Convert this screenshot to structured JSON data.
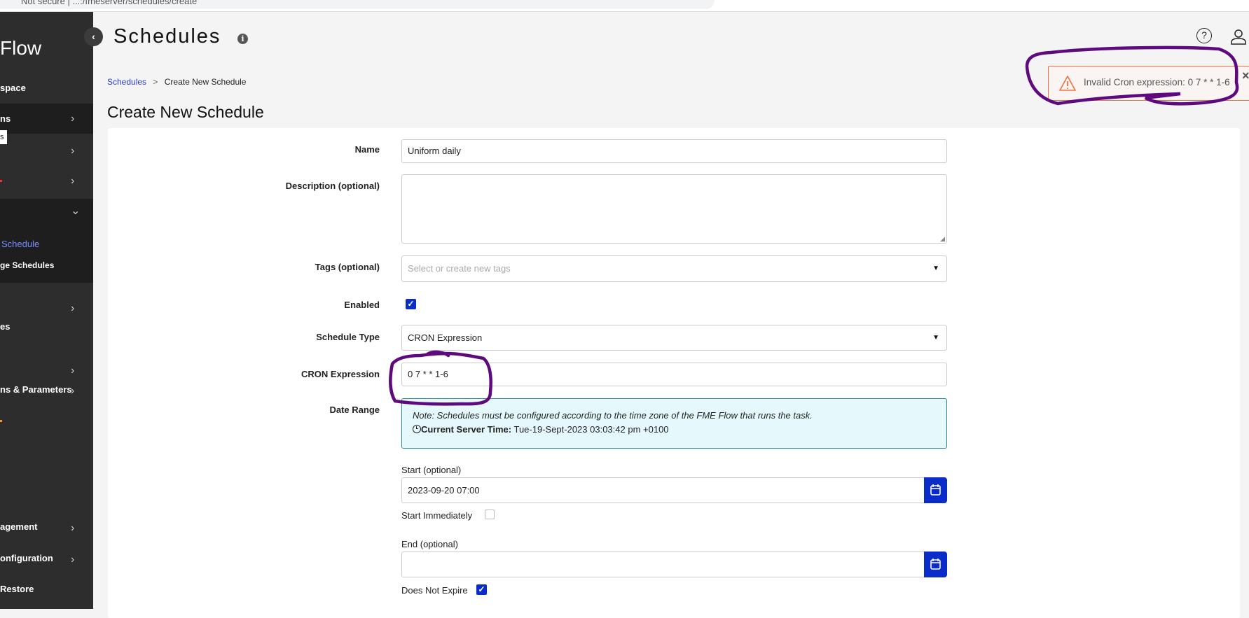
{
  "browser": {
    "url_fragment": "Not secure  |  ...:/fmeserver/schedules/create"
  },
  "sidebar": {
    "logo": "Flow",
    "items": [
      {
        "label": "space",
        "chevron": ""
      },
      {
        "label": "ns",
        "chevron": "›"
      },
      {
        "label": "",
        "chevron": "›"
      },
      {
        "label": "",
        "chevron": "›"
      },
      {
        "label": "",
        "chevron": "⌄"
      },
      {
        "label": "Schedule",
        "chevron": ""
      },
      {
        "label": "ge Schedules",
        "chevron": ""
      },
      {
        "label": "",
        "chevron": "›"
      },
      {
        "label": "es",
        "chevron": ""
      },
      {
        "label": "",
        "chevron": "›"
      },
      {
        "label": "ns & Parameters",
        "chevron": "›"
      },
      {
        "label": "agement",
        "chevron": "›"
      },
      {
        "label": "onfiguration",
        "chevron": "›"
      },
      {
        "label": "Restore",
        "chevron": ""
      }
    ],
    "tooltip": "s",
    "collapse_icon": "‹"
  },
  "header": {
    "title": "Schedules",
    "help_icon": "?"
  },
  "breadcrumb": {
    "root": "Schedules",
    "separator": ">",
    "current": "Create New Schedule"
  },
  "heading": "Create New Schedule",
  "toast": {
    "message": "Invalid Cron expression: 0 7 * * 1-6",
    "close": "×",
    "color": "#f07040"
  },
  "form": {
    "name_label": "Name",
    "name_value": "Uniform daily",
    "description_label": "Description (optional)",
    "description_value": "",
    "tags_label": "Tags (optional)",
    "tags_placeholder": "Select or create new tags",
    "enabled_label": "Enabled",
    "enabled": true,
    "schedule_type_label": "Schedule Type",
    "schedule_type_value": "CRON Expression",
    "cron_label": "CRON Expression",
    "cron_value": "0 7 * * 1-6",
    "date_range_label": "Date Range",
    "note": "Note: Schedules must be configured according to the time zone of the FME Flow that runs the task.",
    "server_time_label": "Current Server Time:",
    "server_time_value": "Tue-19-Sept-2023 03:03:42 pm +0100",
    "start_label": "Start (optional)",
    "start_value": "2023-09-20 07:00",
    "start_immediately_label": "Start Immediately",
    "start_immediately": false,
    "end_label": "End (optional)",
    "end_value": "",
    "does_not_expire_label": "Does Not Expire",
    "does_not_expire": true
  },
  "colors": {
    "accent": "#0a2cc9",
    "sidebar": "#2d2d2d",
    "annotation": "#5e0a7e",
    "link": "#2a3ad6"
  }
}
